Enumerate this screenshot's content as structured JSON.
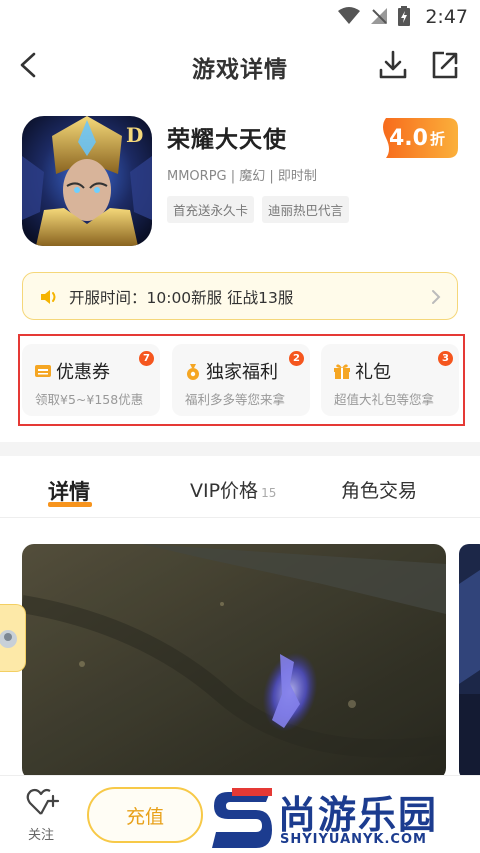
{
  "status_bar": {
    "time": "2:47"
  },
  "nav": {
    "title": "游戏详情"
  },
  "game": {
    "name": "荣耀大天使",
    "meta": "MMORPG | 魔幻 | 即时制",
    "tags": [
      "首充送永久卡",
      "迪丽热巴代言"
    ],
    "discount_value": "4.0",
    "discount_unit": "折"
  },
  "notice": {
    "text": "开服时间：10:00新服 征战13服"
  },
  "cards": [
    {
      "title": "优惠券",
      "subtitle": "领取¥5~¥158优惠",
      "badge": "7"
    },
    {
      "title": "独家福利",
      "subtitle": "福利多多等您来拿",
      "badge": "2"
    },
    {
      "title": "礼包",
      "subtitle": "超值大礼包等您拿",
      "badge": "3"
    }
  ],
  "tabs": [
    {
      "label": "详情",
      "count": ""
    },
    {
      "label": "VIP价格",
      "count": "15"
    },
    {
      "label": "角色交易",
      "count": ""
    }
  ],
  "bottom": {
    "follow_label": "关注",
    "recharge_label": "充值"
  },
  "watermark": {
    "brand": "尚游乐园",
    "domain": "SHYIYUANYK.COM"
  },
  "colors": {
    "accent": "#f7941d",
    "badge": "#f5561e",
    "highlight": "#e53935"
  },
  "icons": [
    "wifi-icon",
    "signal-icon",
    "battery-icon",
    "back-icon",
    "download-icon",
    "share-icon",
    "speaker-icon",
    "coupon-icon",
    "bag-icon",
    "gift-icon",
    "heart-plus-icon",
    "chevron-right-icon"
  ]
}
